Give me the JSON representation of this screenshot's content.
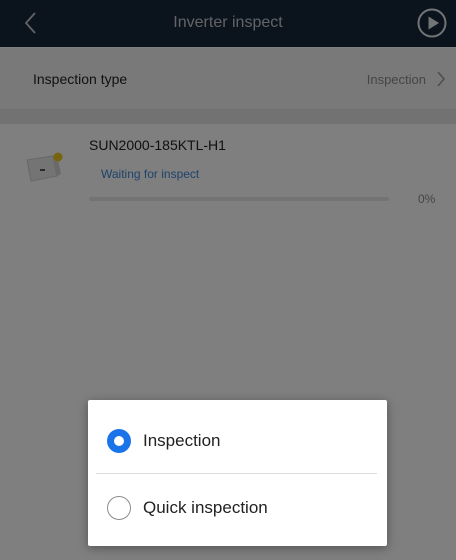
{
  "header": {
    "title": "Inverter inspect",
    "back_icon": "back-chevron-icon",
    "action_icon": "play-circle-icon"
  },
  "inspection_type": {
    "label": "Inspection type",
    "value": "Inspection"
  },
  "device": {
    "name": "SUN2000-185KTL-H1",
    "status": "Waiting for inspect",
    "progress_fraction": 0,
    "progress_text": "0%"
  },
  "dialog": {
    "options": [
      {
        "label": "Inspection",
        "selected": true
      },
      {
        "label": "Quick inspection",
        "selected": false
      }
    ]
  },
  "colors": {
    "header_bg": "#16283a",
    "accent": "#1a73e8",
    "status_blue": "#3d86d6"
  }
}
